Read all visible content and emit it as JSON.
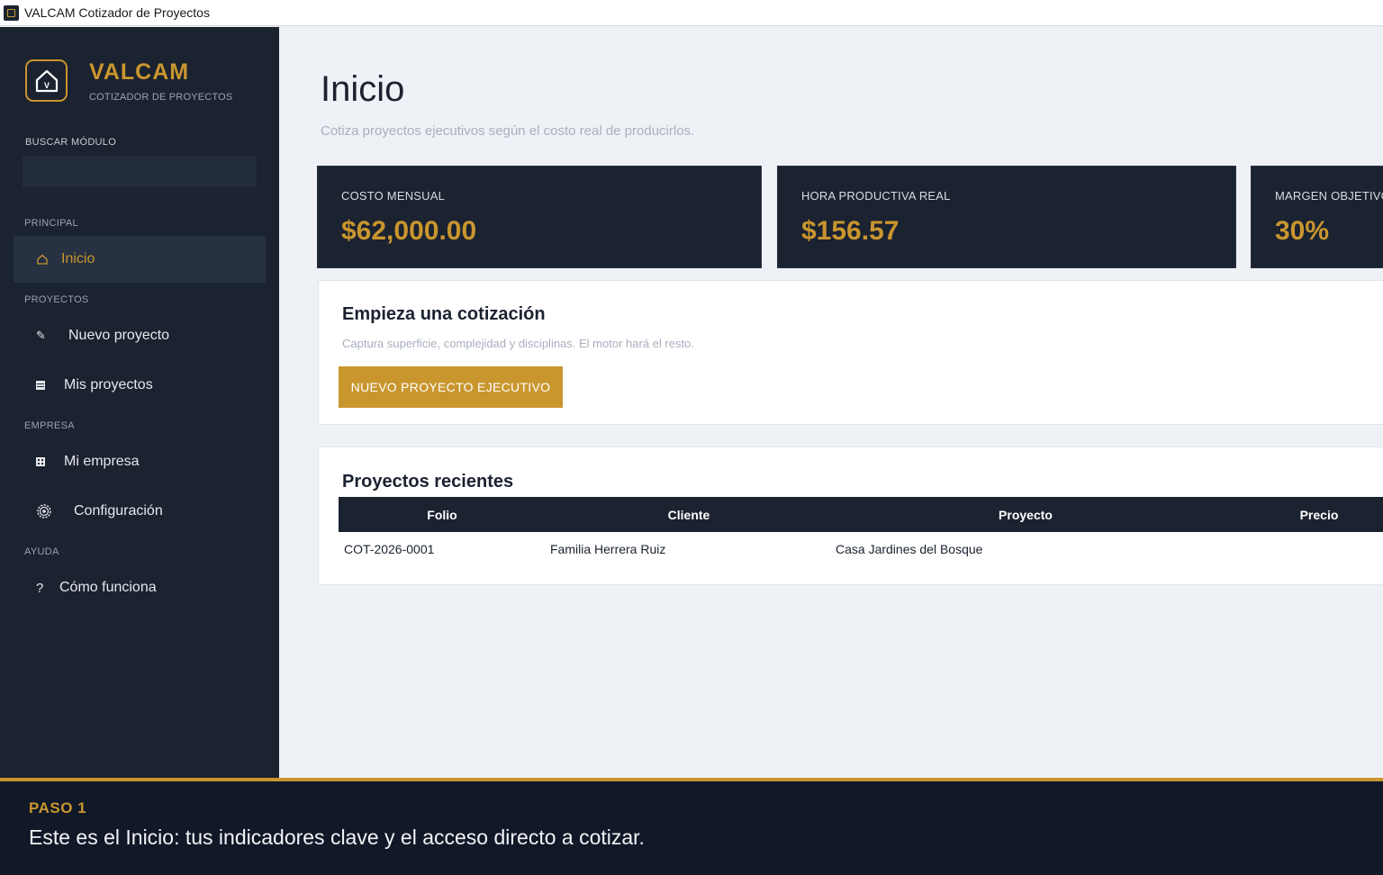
{
  "window": {
    "title": "VALCAM Cotizador de Proyectos"
  },
  "sidebar": {
    "brand": {
      "name": "VALCAM",
      "subtitle": "COTIZADOR DE PROYECTOS"
    },
    "search": {
      "label": "BUSCAR MÓDULO",
      "value": "",
      "placeholder": ""
    },
    "sections": [
      {
        "label": "PRINCIPAL",
        "items": [
          {
            "label": "Inicio",
            "icon": "home-icon",
            "active": true
          }
        ]
      },
      {
        "label": "PROYECTOS",
        "items": [
          {
            "label": "Nuevo proyecto",
            "icon": "pencil-icon"
          },
          {
            "label": "Mis proyectos",
            "icon": "list-icon"
          }
        ]
      },
      {
        "label": "EMPRESA",
        "items": [
          {
            "label": "Mi empresa",
            "icon": "building-icon"
          },
          {
            "label": "Configuración",
            "icon": "gear-icon"
          }
        ]
      },
      {
        "label": "AYUDA",
        "items": [
          {
            "label": "Cómo funciona",
            "icon": "question-icon"
          }
        ]
      }
    ]
  },
  "main": {
    "title": "Inicio",
    "subtitle": "Cotiza proyectos ejecutivos según el costo real de producirlos.",
    "kpis": [
      {
        "label": "COSTO MENSUAL",
        "value": "$62,000.00"
      },
      {
        "label": "HORA PRODUCTIVA REAL",
        "value": "$156.57"
      },
      {
        "label": "MARGEN OBJETIVO",
        "value": "30%"
      }
    ],
    "quote_card": {
      "title": "Empieza una cotización",
      "description": "Captura superficie, complejidad y disciplinas. El motor hará el resto.",
      "button_label": "NUEVO PROYECTO EJECUTIVO"
    },
    "recent": {
      "title": "Proyectos recientes",
      "columns": [
        "Folio",
        "Cliente",
        "Proyecto",
        "Precio"
      ],
      "rows": [
        [
          "COT-2026-0001",
          "Familia Herrera Ruiz",
          "Casa Jardines del Bosque",
          ""
        ]
      ]
    }
  },
  "tutorial": {
    "step_label": "PASO 1",
    "step_text": "Este es el Inicio: tus indicadores clave y el acceso directo a cotizar."
  },
  "colors": {
    "accent": "#c9962e",
    "sidebar": "#1b2230",
    "background": "#eef1f6",
    "tutorial_bar": "#111828"
  }
}
